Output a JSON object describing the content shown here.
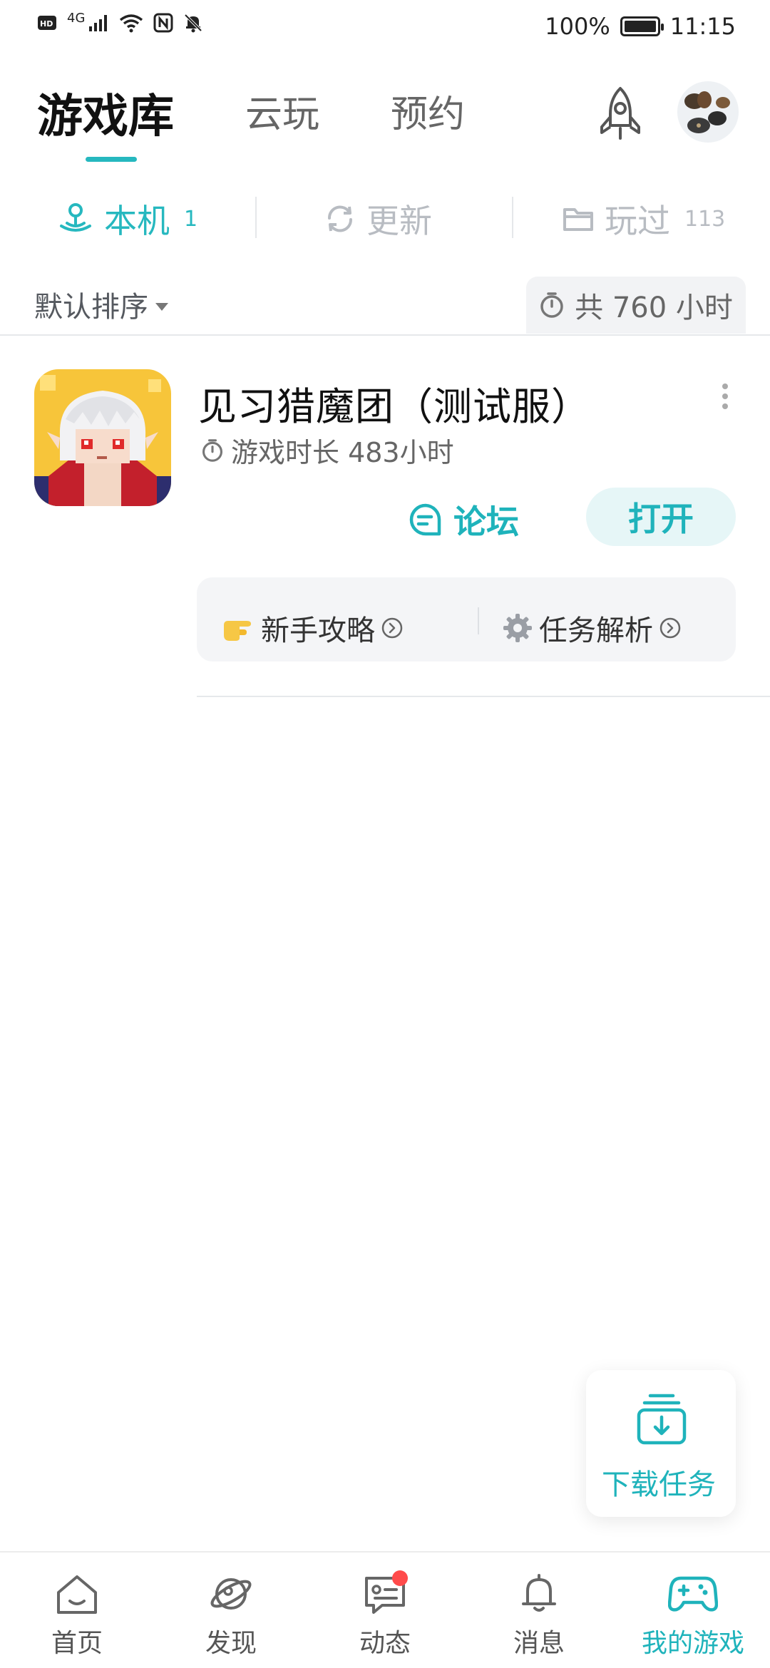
{
  "status_bar": {
    "network_label": "4G",
    "battery": "100%",
    "time": "11:15",
    "icons": [
      "hd-icon",
      "signal-icon",
      "wifi-icon",
      "nfc-icon",
      "bell-muted-icon",
      "battery-icon"
    ]
  },
  "header": {
    "tabs": [
      {
        "label": "游戏库",
        "active": true
      },
      {
        "label": "云玩",
        "active": false
      },
      {
        "label": "预约",
        "active": false
      }
    ],
    "accent_color": "#26b8bf"
  },
  "subtabs": [
    {
      "label": "本机",
      "count": "1",
      "active": true,
      "icon": "joystick-icon"
    },
    {
      "label": "更新",
      "count": "",
      "active": false,
      "icon": "refresh-icon"
    },
    {
      "label": "玩过",
      "count": "113",
      "active": false,
      "icon": "folder-icon"
    }
  ],
  "sort": {
    "label": "默认排序",
    "total_playtime": "共 760 小时"
  },
  "games": [
    {
      "title": "见习猎魔团（测试服）",
      "playtime": "游戏时长 483小时",
      "forum_label": "论坛",
      "open_label": "打开",
      "guides": [
        {
          "label": "新手攻略",
          "icon": "pointing-hand-icon"
        },
        {
          "label": "任务解析",
          "icon": "gear-icon"
        }
      ]
    }
  ],
  "download_task": {
    "label": "下载任务"
  },
  "bottom_nav": [
    {
      "label": "首页",
      "icon": "home-icon",
      "active": false
    },
    {
      "label": "发现",
      "icon": "planet-icon",
      "active": false
    },
    {
      "label": "动态",
      "icon": "chat-icon",
      "active": false,
      "badge": true
    },
    {
      "label": "消息",
      "icon": "bell-icon",
      "active": false
    },
    {
      "label": "我的游戏",
      "icon": "gamepad-icon",
      "active": true
    }
  ]
}
